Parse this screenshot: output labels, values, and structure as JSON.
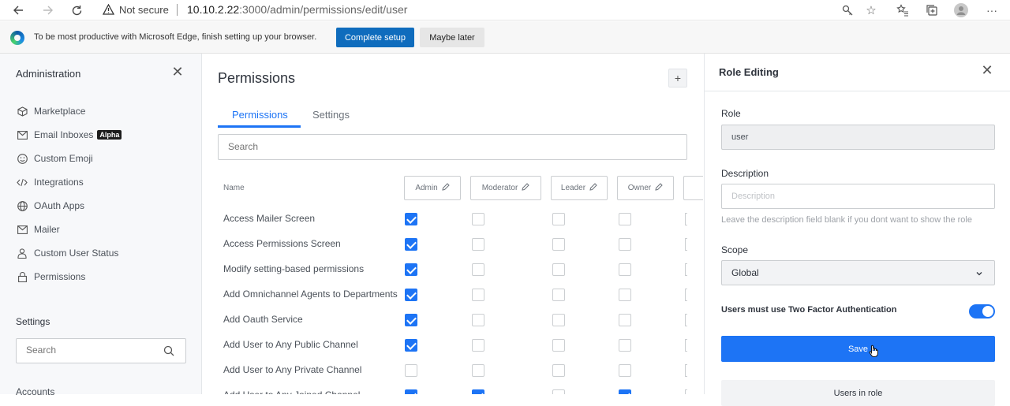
{
  "browser": {
    "security_label": "Not secure",
    "url_host": "10.10.2.22",
    "url_path": ":3000/admin/permissions/edit/user"
  },
  "edge_banner": {
    "message": "To be most productive with Microsoft Edge, finish setting up your browser.",
    "primary_label": "Complete setup",
    "secondary_label": "Maybe later"
  },
  "sidebar": {
    "title": "Administration",
    "items": [
      {
        "label": "Marketplace",
        "icon": "cube-icon"
      },
      {
        "label": "Email Inboxes",
        "icon": "envelope-icon",
        "badge": "Alpha"
      },
      {
        "label": "Custom Emoji",
        "icon": "emoji-icon"
      },
      {
        "label": "Integrations",
        "icon": "code-icon"
      },
      {
        "label": "OAuth Apps",
        "icon": "globe-icon"
      },
      {
        "label": "Mailer",
        "icon": "mail-icon"
      },
      {
        "label": "Custom User Status",
        "icon": "user-icon"
      },
      {
        "label": "Permissions",
        "icon": "lock-icon"
      }
    ],
    "settings_heading": "Settings",
    "search_placeholder": "Search",
    "accounts_label": "Accounts"
  },
  "main": {
    "title": "Permissions",
    "tabs": [
      {
        "label": "Permissions",
        "active": true
      },
      {
        "label": "Settings",
        "active": false
      }
    ],
    "search_placeholder": "Search",
    "name_header": "Name",
    "roles": [
      "Admin",
      "Moderator",
      "Leader",
      "Owner"
    ],
    "permissions": [
      {
        "name": "Access Mailer Screen",
        "checks": [
          true,
          false,
          false,
          false
        ]
      },
      {
        "name": "Access Permissions Screen",
        "checks": [
          true,
          false,
          false,
          false
        ]
      },
      {
        "name": "Modify setting-based permissions",
        "checks": [
          true,
          false,
          false,
          false
        ]
      },
      {
        "name": "Add Omnichannel Agents to Departments",
        "checks": [
          true,
          false,
          false,
          false
        ]
      },
      {
        "name": "Add Oauth Service",
        "checks": [
          true,
          false,
          false,
          false
        ]
      },
      {
        "name": "Add User to Any Public Channel",
        "checks": [
          true,
          false,
          false,
          false
        ]
      },
      {
        "name": "Add User to Any Private Channel",
        "checks": [
          false,
          false,
          false,
          false
        ]
      },
      {
        "name": "Add User to Any Joined Channel",
        "checks": [
          true,
          true,
          false,
          true
        ]
      }
    ]
  },
  "role_panel": {
    "title": "Role Editing",
    "role_label": "Role",
    "role_value": "user",
    "description_label": "Description",
    "description_placeholder": "Description",
    "description_hint": "Leave the description field blank if you dont want to show the role",
    "scope_label": "Scope",
    "scope_value": "Global",
    "two_factor_label": "Users must use Two Factor Authentication",
    "two_factor_enabled": true,
    "save_label": "Save",
    "users_in_role_label": "Users in role"
  },
  "colors": {
    "accent": "#1d74f5",
    "edge_button": "#0f6cbd"
  }
}
